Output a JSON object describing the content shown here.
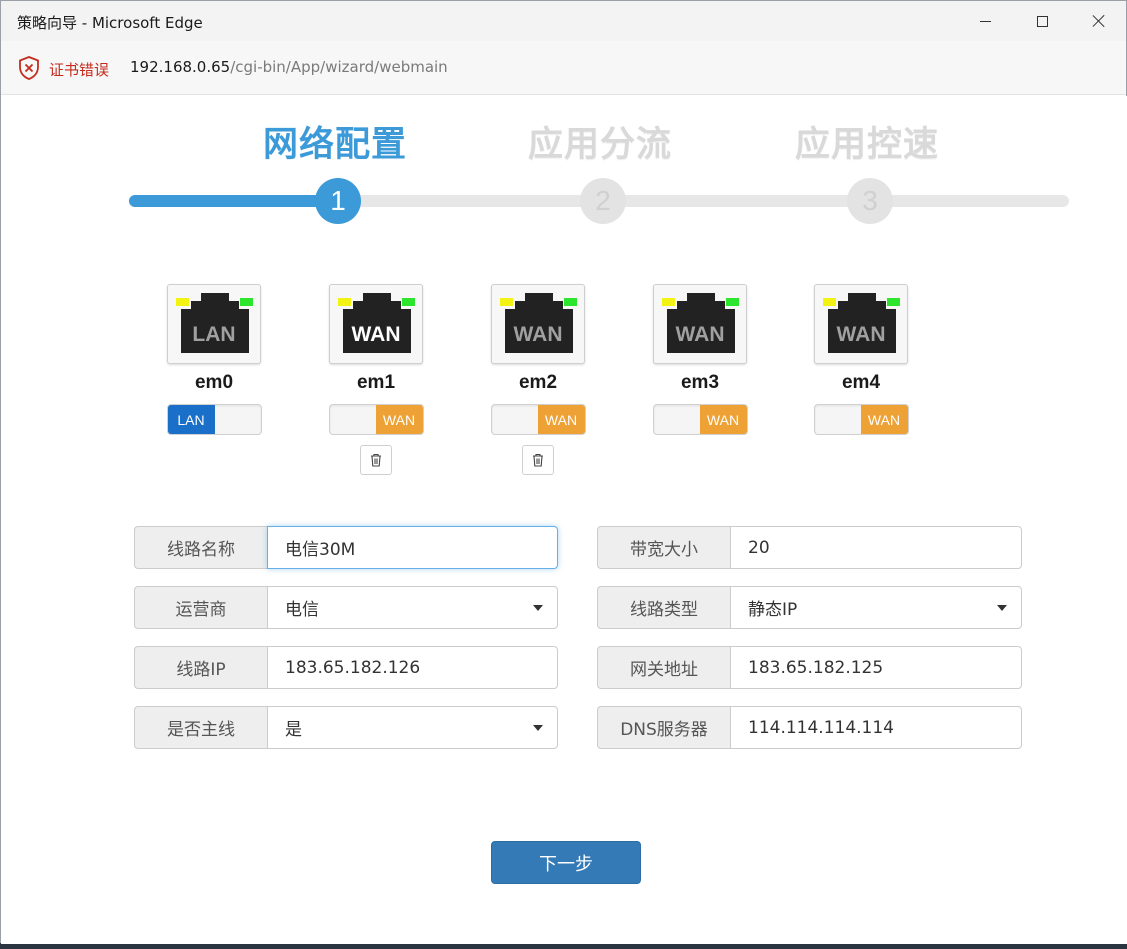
{
  "window": {
    "title": "策略向导 - Microsoft Edge"
  },
  "address": {
    "cert_warning": "证书错误",
    "url_host": "192.168.0.65",
    "url_path": "/cgi-bin/App/wizard/webmain"
  },
  "wizard": {
    "steps": [
      {
        "title": "网络配置",
        "number": "1",
        "state": "active"
      },
      {
        "title": "应用分流",
        "number": "2",
        "state": "inactive"
      },
      {
        "title": "应用控速",
        "number": "3",
        "state": "inactive"
      }
    ],
    "progress_fraction": 0.22
  },
  "ports": [
    {
      "name": "em0",
      "jack_label": "LAN",
      "mode": "LAN",
      "deletable": false
    },
    {
      "name": "em1",
      "jack_label": "WAN",
      "mode": "WAN",
      "deletable": true
    },
    {
      "name": "em2",
      "jack_label": "WAN",
      "mode": "WAN",
      "deletable": true
    },
    {
      "name": "em3",
      "jack_label": "WAN",
      "mode": "WAN",
      "deletable": false
    },
    {
      "name": "em4",
      "jack_label": "WAN",
      "mode": "WAN",
      "deletable": false
    }
  ],
  "toggle_labels": {
    "lan": "LAN",
    "wan": "WAN"
  },
  "form": {
    "line_name": {
      "label": "线路名称",
      "value": "电信30M"
    },
    "bandwidth": {
      "label": "带宽大小",
      "value": "20"
    },
    "isp": {
      "label": "运营商",
      "value": "电信"
    },
    "line_type": {
      "label": "线路类型",
      "value": "静态IP"
    },
    "line_ip": {
      "label": "线路IP",
      "value": "183.65.182.126"
    },
    "gateway": {
      "label": "网关地址",
      "value": "183.65.182.125"
    },
    "is_primary": {
      "label": "是否主线",
      "value": "是"
    },
    "dns": {
      "label": "DNS服务器",
      "value": "114.114.114.114"
    }
  },
  "next_button": "下一步",
  "colors": {
    "accent": "#3c9ad8",
    "lan": "#1a6fc9",
    "wan": "#eea236",
    "button": "#337ab7",
    "cert_error": "#c42b1c"
  }
}
